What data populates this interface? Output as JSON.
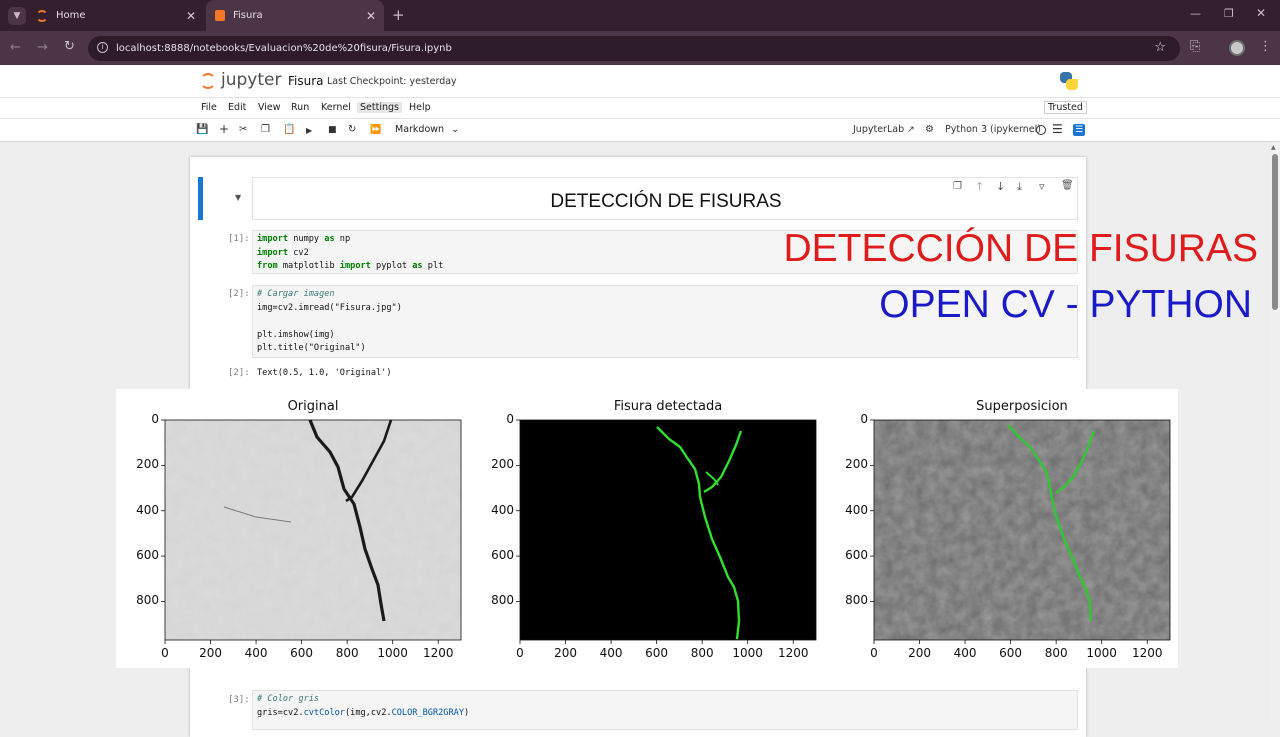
{
  "browser": {
    "tabs": [
      {
        "label": "Home",
        "active": false
      },
      {
        "label": "Fisura",
        "active": true
      }
    ],
    "url": "localhost:8888/notebooks/Evaluacion%20de%20fisura/Fisura.ipynb"
  },
  "jupyter": {
    "logo_text": "jupyter",
    "notebook_name": "Fisura",
    "checkpoint": "Last Checkpoint: yesterday",
    "menu": [
      "File",
      "Edit",
      "View",
      "Run",
      "Kernel",
      "Settings",
      "Help"
    ],
    "trusted": "Trusted",
    "cell_type": "Markdown",
    "jupyterlab_label": "JupyterLab",
    "kernel": "Python 3 (ipykernel)"
  },
  "notebook": {
    "markdown_heading": "DETECCIÓN DE FISURAS",
    "cells": [
      {
        "prompt": "[1]:",
        "lines": [
          "import numpy as np",
          "import cv2",
          "from matplotlib import pyplot as plt"
        ]
      },
      {
        "prompt": "[2]:",
        "lines": [
          "# Cargar imagen",
          "img=cv2.imread(\"Fisura.jpg\")",
          "",
          "plt.imshow(img)",
          "plt.title(\"Original\")"
        ]
      },
      {
        "prompt": "[3]:",
        "lines": [
          "# Color gris",
          "gris=cv2.cvtColor(img,cv2.COLOR_BGR2GRAY)"
        ]
      }
    ],
    "output_prompt": "[2]:",
    "output_text": "Text(0.5, 1.0, 'Original')"
  },
  "overlay": {
    "line1": "DETECCIÓN DE FISURAS",
    "line2": "OPEN CV - PYTHON",
    "line1_color": "#e01b1b",
    "line2_color": "#1a1ac8"
  },
  "figure": {
    "panels": [
      {
        "title": "Original"
      },
      {
        "title": "Fisura detectada"
      },
      {
        "title": "Superposicion"
      }
    ],
    "x_ticks": [
      "0",
      "200",
      "400",
      "600",
      "800",
      "1000",
      "1200"
    ],
    "y_ticks": [
      "0",
      "200",
      "400",
      "600",
      "800"
    ],
    "crack_color": "#2fe02f"
  }
}
